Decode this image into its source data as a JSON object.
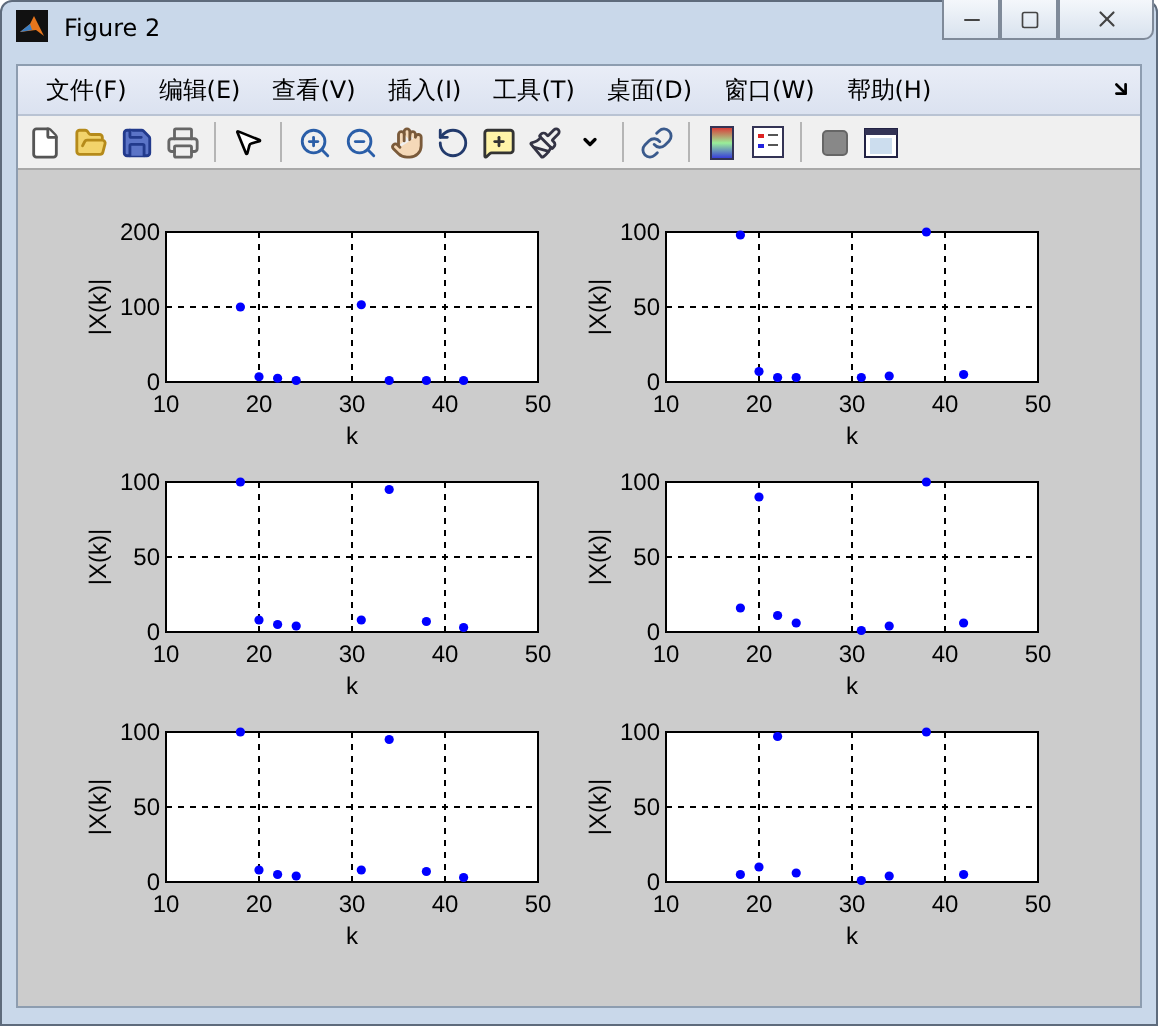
{
  "window": {
    "title": "Figure 2"
  },
  "menu": [
    "文件(F)",
    "编辑(E)",
    "查看(V)",
    "插入(I)",
    "工具(T)",
    "桌面(D)",
    "窗口(W)",
    "帮助(H)"
  ],
  "plots": [
    {
      "chart_data": {
        "type": "scatter",
        "xlabel": "k",
        "ylabel": "|X(k)|",
        "x": [
          18,
          20,
          22,
          24,
          31,
          34,
          38,
          42
        ],
        "series": [
          {
            "color": "#0000ff",
            "values": [
              100,
              7,
              5,
              2,
              103,
              2,
              2,
              2
            ]
          }
        ],
        "xlim": [
          10,
          50
        ],
        "ylim": [
          0,
          200
        ],
        "xticks": [
          10,
          20,
          30,
          40,
          50
        ],
        "yticks": [
          0,
          100,
          200
        ],
        "grid": true
      }
    },
    {
      "chart_data": {
        "type": "scatter",
        "xlabel": "k",
        "ylabel": "|X(k)|",
        "x": [
          18,
          20,
          22,
          24,
          31,
          34,
          38,
          42
        ],
        "series": [
          {
            "color": "#0000ff",
            "values": [
              98,
              7,
              3,
              3,
              3,
              4,
              100,
              5
            ]
          }
        ],
        "xlim": [
          10,
          50
        ],
        "ylim": [
          0,
          100
        ],
        "xticks": [
          10,
          20,
          30,
          40,
          50
        ],
        "yticks": [
          0,
          50,
          100
        ],
        "grid": true
      }
    },
    {
      "chart_data": {
        "type": "scatter",
        "xlabel": "k",
        "ylabel": "|X(k)|",
        "x": [
          18,
          20,
          22,
          24,
          31,
          34,
          38,
          42
        ],
        "series": [
          {
            "color": "#0000ff",
            "values": [
              100,
              8,
              5,
              4,
              8,
              95,
              7,
              3
            ]
          }
        ],
        "xlim": [
          10,
          50
        ],
        "ylim": [
          0,
          100
        ],
        "xticks": [
          10,
          20,
          30,
          40,
          50
        ],
        "yticks": [
          0,
          50,
          100
        ],
        "grid": true
      }
    },
    {
      "chart_data": {
        "type": "scatter",
        "xlabel": "k",
        "ylabel": "|X(k)|",
        "x": [
          18,
          20,
          22,
          24,
          31,
          34,
          38,
          42
        ],
        "series": [
          {
            "color": "#0000ff",
            "values": [
              16,
              90,
              11,
              6,
              1,
              4,
              100,
              6
            ]
          }
        ],
        "xlim": [
          10,
          50
        ],
        "ylim": [
          0,
          100
        ],
        "xticks": [
          10,
          20,
          30,
          40,
          50
        ],
        "yticks": [
          0,
          50,
          100
        ],
        "grid": true
      }
    },
    {
      "chart_data": {
        "type": "scatter",
        "xlabel": "k",
        "ylabel": "|X(k)|",
        "x": [
          18,
          20,
          22,
          24,
          31,
          34,
          38,
          42
        ],
        "series": [
          {
            "color": "#0000ff",
            "values": [
              100,
              8,
              5,
              4,
              8,
              95,
              7,
              3
            ]
          }
        ],
        "xlim": [
          10,
          50
        ],
        "ylim": [
          0,
          100
        ],
        "xticks": [
          10,
          20,
          30,
          40,
          50
        ],
        "yticks": [
          0,
          50,
          100
        ],
        "grid": true
      }
    },
    {
      "chart_data": {
        "type": "scatter",
        "xlabel": "k",
        "ylabel": "|X(k)|",
        "x": [
          18,
          20,
          22,
          24,
          31,
          34,
          38,
          42
        ],
        "series": [
          {
            "color": "#0000ff",
            "values": [
              5,
              10,
              97,
              6,
              1,
              4,
              100,
              5
            ]
          }
        ],
        "xlim": [
          10,
          50
        ],
        "ylim": [
          0,
          100
        ],
        "xticks": [
          10,
          20,
          30,
          40,
          50
        ],
        "yticks": [
          0,
          50,
          100
        ],
        "grid": true
      }
    }
  ]
}
